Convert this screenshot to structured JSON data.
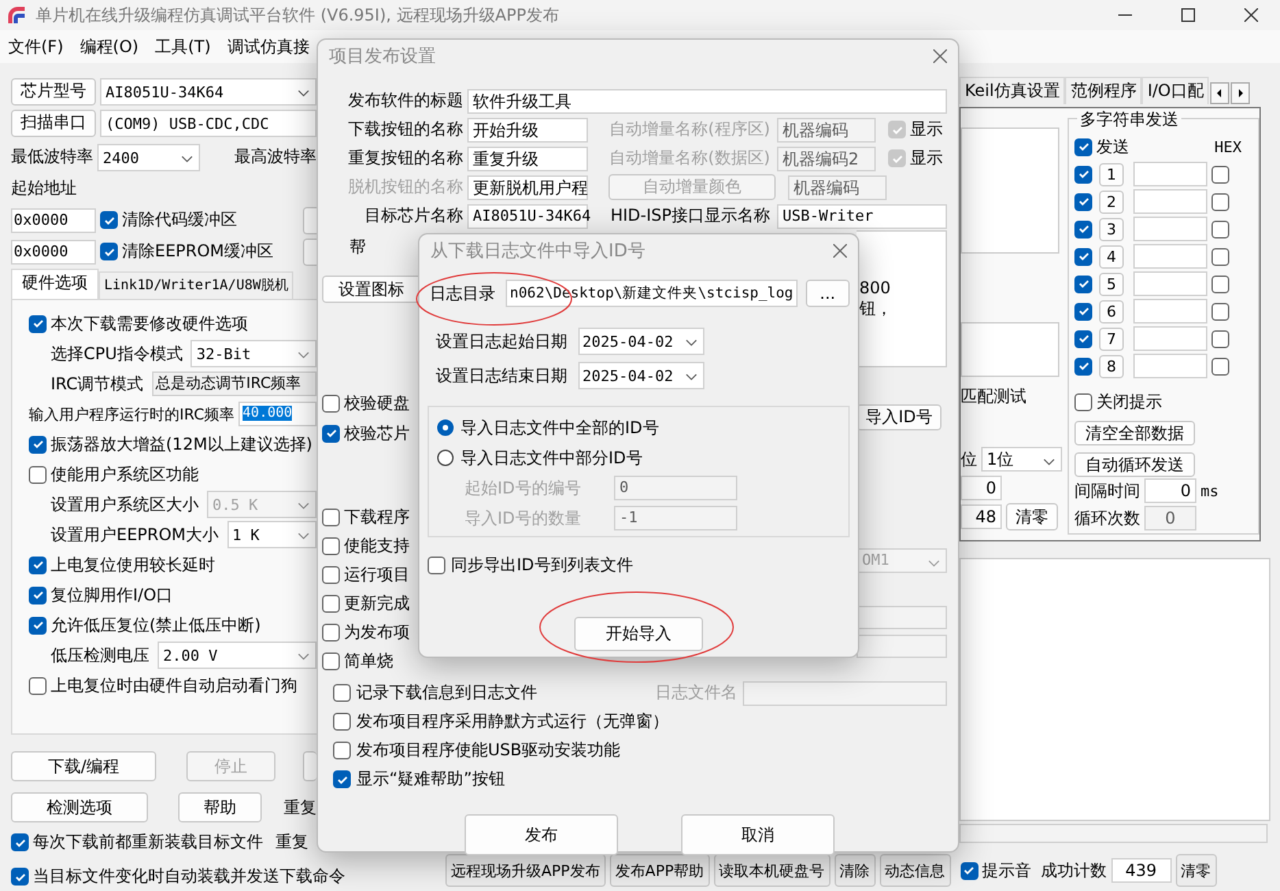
{
  "main_window": {
    "title": "单片机在线升级编程仿真调试平台软件 (V6.95I), 远程现场升级APP发布",
    "menu": [
      "文件(F)",
      "编程(O)",
      "工具(T)",
      "调试仿真接"
    ],
    "left_panel": {
      "chip_button": "芯片型号",
      "chip_value": "AI8051U-34K64",
      "scan_button": "扫描串口",
      "port_value": "(COM9) USB-CDC,CDC",
      "min_baud_label": "最低波特率",
      "min_baud_value": "2400",
      "max_baud_label": "最高波特率",
      "start_address_label": "起始地址",
      "address_rows": [
        {
          "value": "0x0000",
          "label": "清除代码缓冲区",
          "checked": true
        },
        {
          "value": "0x0000",
          "label": "清除EEPROM缓冲区",
          "checked": true
        }
      ],
      "tabs": [
        {
          "label": "硬件选项",
          "selected": true
        },
        {
          "label": "Link1D/Writer1A/U8W脱机",
          "selected": false
        }
      ],
      "hardware_options": [
        {
          "kind": "check",
          "label": "本次下载需要修改硬件选项",
          "checked": true
        },
        {
          "kind": "select",
          "label": "选择CPU指令模式",
          "value": "32-Bit",
          "disabled": false
        },
        {
          "kind": "text",
          "label": "IRC调节模式",
          "value": "总是动态调节IRC频率"
        },
        {
          "kind": "input",
          "label": "输入用户程序运行时的IRC频率",
          "value": "40.000",
          "text_selected": true
        },
        {
          "kind": "check",
          "label": "振荡器放大增益(12M以上建议选择)",
          "checked": true
        },
        {
          "kind": "check",
          "label": "使能用户系统区功能",
          "checked": false
        },
        {
          "kind": "select",
          "label": "设置用户系统区大小",
          "value": "0.5 K",
          "disabled": true
        },
        {
          "kind": "select",
          "label": "设置用户EEPROM大小",
          "value": "1    K",
          "disabled": false
        },
        {
          "kind": "check",
          "label": "上电复位使用较长延时",
          "checked": true
        },
        {
          "kind": "check",
          "label": "复位脚用作I/O口",
          "checked": true
        },
        {
          "kind": "check",
          "label": "允许低压复位(禁止低压中断)",
          "checked": true
        },
        {
          "kind": "select",
          "label": "低压检测电压",
          "value": "2.00 V",
          "disabled": false
        },
        {
          "kind": "check",
          "label": "上电复位时由硬件自动启动看门狗",
          "checked": false
        }
      ],
      "button_rows": [
        [
          {
            "label": "下载/编程",
            "disabled": false
          },
          {
            "label": "停止",
            "disabled": true
          }
        ],
        [
          {
            "label": "检测选项",
            "disabled": false
          },
          {
            "label": "帮助",
            "disabled": false
          }
        ]
      ],
      "repeat_label": "重复",
      "bottom_checks": [
        {
          "label": "每次下载前都重新装载目标文件",
          "checked": true,
          "side_text": "重复"
        },
        {
          "label": "当目标文件变化时自动装载并发送下载命令",
          "checked": true
        }
      ]
    },
    "right_panel": {
      "tabs": [
        {
          "label": "Keil仿真设置",
          "selected": false
        },
        {
          "label": "范例程序",
          "selected": false
        },
        {
          "label": "I/O口配",
          "selected": false
        }
      ],
      "match_test_label": "匹配测试",
      "bits_label": "位",
      "bits_value": "1位",
      "counter_values": [
        "0",
        "48"
      ],
      "reset_button": "清零",
      "multi_send": {
        "title": "多字符串发送",
        "send_label": "发送",
        "send_checked": true,
        "hex_label": "HEX",
        "rows": [
          {
            "number": "1",
            "checked": true,
            "hex": false
          },
          {
            "number": "2",
            "checked": true,
            "hex": false
          },
          {
            "number": "3",
            "checked": true,
            "hex": false
          },
          {
            "number": "4",
            "checked": true,
            "hex": false
          },
          {
            "number": "5",
            "checked": true,
            "hex": false
          },
          {
            "number": "6",
            "checked": true,
            "hex": false
          },
          {
            "number": "7",
            "checked": true,
            "hex": false
          },
          {
            "number": "8",
            "checked": true,
            "hex": false
          }
        ],
        "close_tip": {
          "label": "关闭提示",
          "checked": false
        },
        "buttons": [
          "清空全部数据",
          "自动循环发送"
        ],
        "interval_label": "间隔时间",
        "interval_value": "0",
        "interval_unit": "ms",
        "loop_label": "循环次数",
        "loop_value": "0"
      }
    },
    "bottom_bar": {
      "buttons": [
        "远程现场升级APP发布",
        "发布APP帮助",
        "读取本机硬盘号",
        "清除",
        "动态信息"
      ],
      "sound": {
        "label": "提示音",
        "checked": true
      },
      "count_label": "成功计数",
      "count_value": "439",
      "reset_button": "清零"
    }
  },
  "publish_dialog": {
    "title": "项目发布设置",
    "title_label": "发布软件的标题",
    "title_value": "软件升级工具",
    "name_rows": [
      {
        "label": "下载按钮的名称",
        "value": "开始升级",
        "disabled": false,
        "aux": {
          "kind": "label",
          "text": "自动增量名称(程序区)",
          "disabled": true,
          "value": "机器编码",
          "show": {
            "label": "显示",
            "checked": true
          }
        }
      },
      {
        "label": "重复按钮的名称",
        "value": "重复升级",
        "disabled": false,
        "aux": {
          "kind": "label",
          "text": "自动增量名称(数据区)",
          "disabled": true,
          "value": "机器编码2",
          "show": {
            "label": "显示",
            "checked": true
          }
        }
      },
      {
        "label": "脱机按钮的名称",
        "value": "更新脱机用户程",
        "disabled": true,
        "aux": {
          "kind": "button",
          "text": "自动增量颜色",
          "disabled": true,
          "value": "机器编码"
        }
      },
      {
        "label": "目标芯片名称",
        "value": "AI8051U-34K64",
        "disabled": false,
        "aux": {
          "kind": "wide",
          "text": "HID-ISP接口显示名称",
          "disabled": false,
          "value": "USB-Writer"
        }
      }
    ],
    "help_label": "帮",
    "help_text_fragments": [
      "800",
      "钮，"
    ],
    "icon_button": "设置图标",
    "verify_checks": [
      {
        "label": "校验硬盘",
        "checked": false
      },
      {
        "label": "校验芯片",
        "checked": true
      }
    ],
    "import_id_button": "导入ID号",
    "option_checks": [
      {
        "label": "下载程序",
        "checked": false
      },
      {
        "label": "使能支持",
        "checked": false
      },
      {
        "label": "运行项目",
        "checked": false
      },
      {
        "label": "更新完成",
        "checked": false
      },
      {
        "label": "为发布项",
        "checked": false
      },
      {
        "label": "简单烧",
        "checked": false
      }
    ],
    "port_value": "OM1",
    "log_check": {
      "label": "记录下载信息到日志文件",
      "checked": false
    },
    "log_name_label": "日志文件名",
    "more_checks": [
      {
        "label": "发布项目程序采用静默方式运行（无弹窗）",
        "checked": false
      },
      {
        "label": "发布项目程序使能USB驱动安装功能",
        "checked": false
      },
      {
        "label": "显示“疑难帮助”按钮",
        "checked": true
      }
    ],
    "buttons": [
      "发布",
      "取消"
    ]
  },
  "import_dialog": {
    "title": "从下载日志文件中导入ID号",
    "dir_label": "日志目录",
    "dir_value": "n062\\Desktop\\新建文件夹\\stcisp_log",
    "dir_circled": true,
    "browse_button": "...",
    "dates": [
      {
        "label": "设置日志起始日期",
        "value": "2025-04-02"
      },
      {
        "label": "设置日志结束日期",
        "value": "2025-04-02"
      }
    ],
    "radios": [
      {
        "label": "导入日志文件中全部的ID号",
        "selected": true
      },
      {
        "label": "导入日志文件中部分ID号",
        "selected": false
      }
    ],
    "range_fields": [
      {
        "label": "起始ID号的编号",
        "value": "0",
        "disabled": true
      },
      {
        "label": "导入ID号的数量",
        "value": "-1",
        "disabled": true
      }
    ],
    "sync_check": {
      "label": "同步导出ID号到列表文件",
      "checked": false
    },
    "start_button": "开始导入",
    "start_circled": true
  }
}
